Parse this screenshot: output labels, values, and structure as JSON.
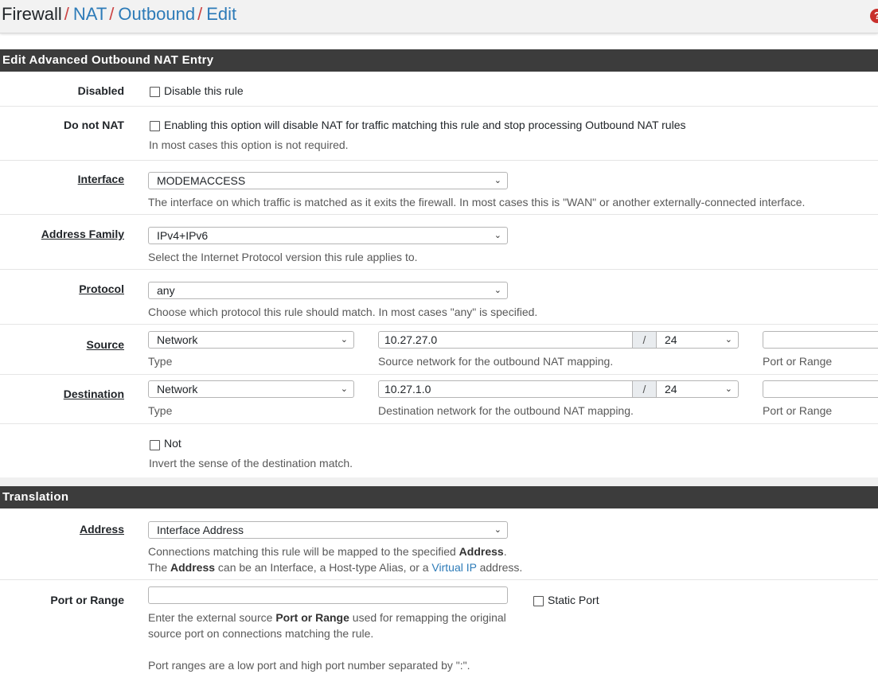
{
  "breadcrumb": {
    "items": [
      "Firewall",
      "NAT",
      "Outbound",
      "Edit"
    ],
    "separator": "/"
  },
  "help_icon": "question-circle-icon",
  "section_edit": {
    "title": "Edit Advanced Outbound NAT Entry"
  },
  "disabled": {
    "label": "Disabled",
    "checkbox_label": "Disable this rule",
    "checked": false
  },
  "do_not_nat": {
    "label": "Do not NAT",
    "checkbox_label": "Enabling this option will disable NAT for traffic matching this rule and stop processing Outbound NAT rules",
    "help": "In most cases this option is not required.",
    "checked": false
  },
  "interface": {
    "label": "Interface",
    "value": "MODEMACCESS",
    "help": "The interface on which traffic is matched as it exits the firewall. In most cases this is \"WAN\" or another externally-connected interface."
  },
  "address_family": {
    "label": "Address Family",
    "value": "IPv4+IPv6",
    "help": "Select the Internet Protocol version this rule applies to."
  },
  "protocol": {
    "label": "Protocol",
    "value": "any",
    "help": "Choose which protocol this rule should match. In most cases \"any\" is specified."
  },
  "source": {
    "label": "Source",
    "type_value": "Network",
    "type_help": "Type",
    "network": "10.27.27.0",
    "slash": "/",
    "mask": "24",
    "network_help": "Source network for the outbound NAT mapping.",
    "port": "",
    "port_help": "Port or Range"
  },
  "destination": {
    "label": "Destination",
    "type_value": "Network",
    "type_help": "Type",
    "network": "10.27.1.0",
    "slash": "/",
    "mask": "24",
    "network_help": "Destination network for the outbound NAT mapping.",
    "port": "",
    "port_help": "Port or Range"
  },
  "not": {
    "checkbox_label": "Not",
    "help": "Invert the sense of the destination match.",
    "checked": false
  },
  "section_translation": {
    "title": "Translation"
  },
  "address": {
    "label": "Address",
    "value": "Interface Address",
    "help_line1_pre": "Connections matching this rule will be mapped to the specified ",
    "help_line1_bold": "Address",
    "help_line1_post": ".",
    "help_line2_pre": "The ",
    "help_line2_bold": "Address",
    "help_line2_mid": " can be an Interface, a Host-type Alias, or a ",
    "help_line2_link": "Virtual IP",
    "help_line2_post": " address."
  },
  "port_or_range": {
    "label": "Port or Range",
    "value": "",
    "static_port_label": "Static Port",
    "static_port_checked": false,
    "help_line1_pre": "Enter the external source ",
    "help_line1_bold": "Port or Range",
    "help_line1_post": " used for remapping the original",
    "help_line2": "source port on connections matching the rule.",
    "help_line3": "Port ranges are a low port and high port number separated by \":\"."
  }
}
